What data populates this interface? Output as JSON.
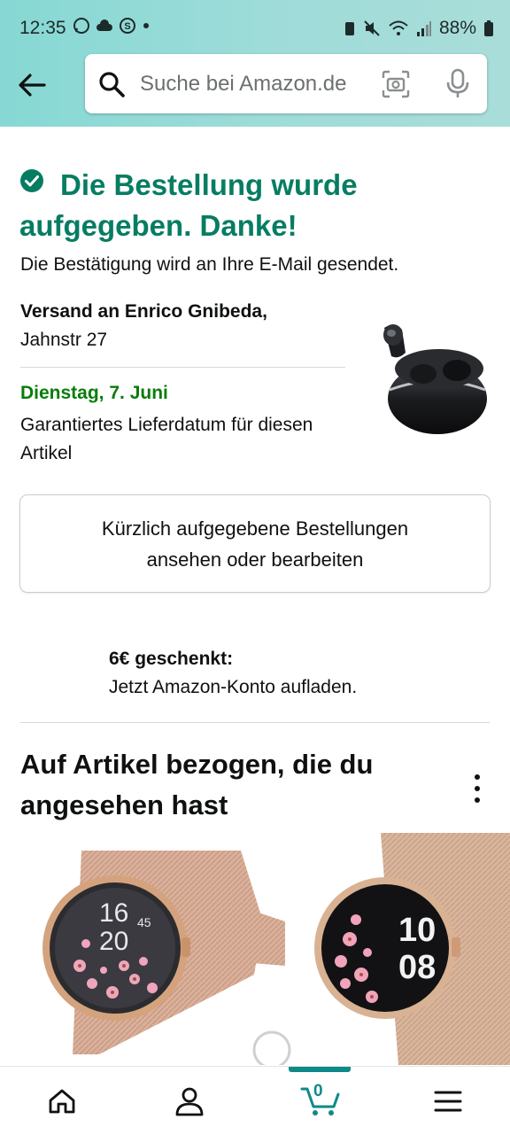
{
  "status_bar": {
    "time": "12:35",
    "battery": "88%"
  },
  "search": {
    "placeholder": "Suche bei Amazon.de"
  },
  "confirmation": {
    "title_line1": "Die Bestellung wurde",
    "title_line2": "aufgegeben. Danke!",
    "email_note": "Die Bestätigung wird an Ihre E-Mail gesendet.",
    "ship_to": "Versand an Enrico Gnibeda,",
    "street": "Jahnstr 27",
    "delivery_date": "Dienstag, 7. Juni",
    "delivery_note": "Garantiertes Lieferdatum für diesen Artikel"
  },
  "orders_button": {
    "label": "Kürzlich aufgegebene Bestellungen ansehen oder bearbeiten"
  },
  "promo": {
    "title": "6€ geschenkt:",
    "text": "Jetzt Amazon-Konto aufladen."
  },
  "recommendations": {
    "title": "Auf Artikel bezogen, die du angesehen hast",
    "items": [
      {
        "watch_hour": "16",
        "watch_minute": "20",
        "watch_sub": "45"
      },
      {
        "watch_hour": "10",
        "watch_minute": "08"
      }
    ]
  },
  "bottom_nav": {
    "cart_count": "0"
  },
  "colors": {
    "accent": "#067d62",
    "delivery": "#0a7c0a",
    "nav_active": "#0e8a88"
  }
}
